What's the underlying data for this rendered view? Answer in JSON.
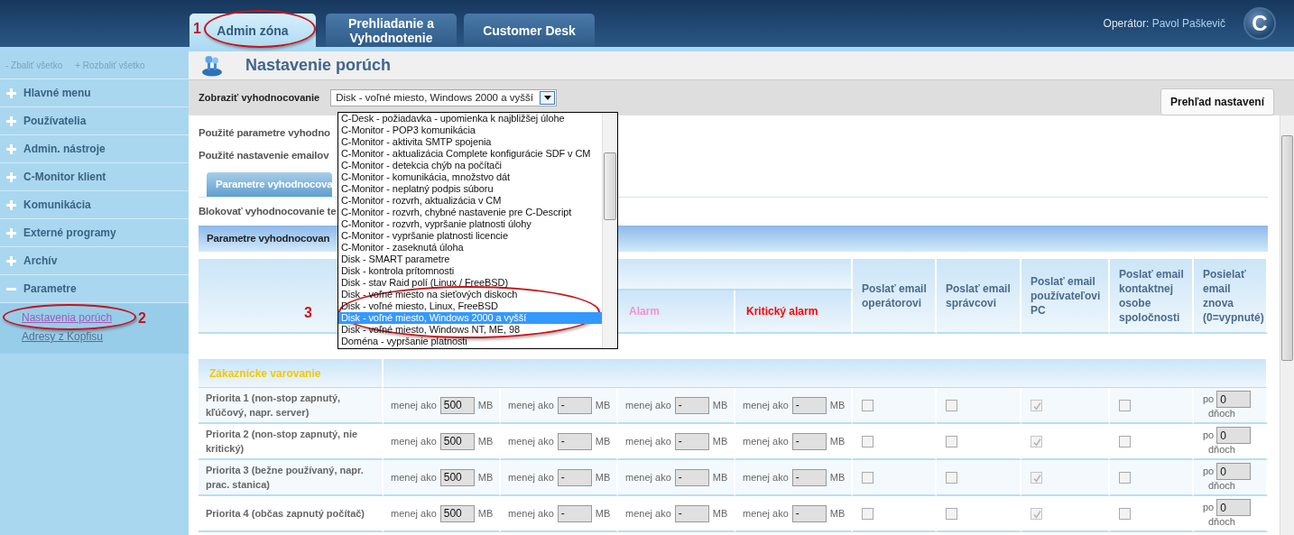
{
  "header": {
    "tabs": [
      {
        "label": "Admin zóna",
        "selected": true,
        "annotation": "1"
      },
      {
        "label": "Prehliadanie a Vyhodnotenie",
        "selected": false
      },
      {
        "label": "Customer Desk",
        "selected": false
      }
    ],
    "operator_label": "Operátor:",
    "operator_name": "Pavol Paškevič",
    "logo_letter": "C"
  },
  "sidebar": {
    "collapse_all": "- Zbaliť všetko",
    "expand_all": "+ Rozbaliť všetko",
    "items": [
      {
        "label": "Hlavné menu",
        "expanded": false
      },
      {
        "label": "Používatelia",
        "expanded": false
      },
      {
        "label": "Admin. nástroje",
        "expanded": false
      },
      {
        "label": "C-Monitor klient",
        "expanded": false
      },
      {
        "label": "Komunikácia",
        "expanded": false
      },
      {
        "label": "Externé programy",
        "expanded": false
      },
      {
        "label": "Archív",
        "expanded": false
      },
      {
        "label": "Parametre",
        "expanded": true,
        "children": [
          {
            "label": "Nastavenia porúch",
            "selected": true,
            "annotation": "2"
          },
          {
            "label": "Adresy z Kopfisu",
            "selected": false
          }
        ]
      }
    ]
  },
  "page": {
    "title": "Nastavenie porúch",
    "filter_label": "Zobraziť vyhodnocovanie",
    "filter_value": "Disk - voľné miesto, Windows 2000 a vyšší",
    "overview_button": "Prehľad nastavení"
  },
  "dropdown": {
    "expanded": true,
    "annotation": "3",
    "options": [
      {
        "label": "C-Desk - požiadavka - upomienka k najbližšej úlohe",
        "selected": false,
        "circled": false
      },
      {
        "label": "C-Monitor - POP3 komunikácia",
        "selected": false,
        "circled": false
      },
      {
        "label": "C-Monitor - aktivita SMTP spojenia",
        "selected": false,
        "circled": false
      },
      {
        "label": "C-Monitor - aktualizácia Complete konfigurácie SDF v CM",
        "selected": false,
        "circled": false
      },
      {
        "label": "C-Monitor - detekcia chýb na počítači",
        "selected": false,
        "circled": false
      },
      {
        "label": "C-Monitor - komunikácia, množstvo dát",
        "selected": false,
        "circled": false
      },
      {
        "label": "C-Monitor - neplatný podpis súboru",
        "selected": false,
        "circled": false
      },
      {
        "label": "C-Monitor - rozvrh, aktualizácia v CM",
        "selected": false,
        "circled": false
      },
      {
        "label": "C-Monitor - rozvrh, chybné nastavenie pre C-Descript",
        "selected": false,
        "circled": false
      },
      {
        "label": "C-Monitor - rozvrh, vypršanie platnosti úlohy",
        "selected": false,
        "circled": false
      },
      {
        "label": "C-Monitor - vypršanie platnosti licencie",
        "selected": false,
        "circled": false
      },
      {
        "label": "C-Monitor - zaseknutá úloha",
        "selected": false,
        "circled": false
      },
      {
        "label": "Disk - SMART parametre",
        "selected": false,
        "circled": false
      },
      {
        "label": "Disk - kontrola prítomnosti",
        "selected": false,
        "circled": false
      },
      {
        "label": "Disk - stav Raid polí (Linux / FreeBSD)",
        "selected": false,
        "circled": false
      },
      {
        "label": "Disk - voľné miesto na sieťových diskoch",
        "selected": false,
        "circled": true
      },
      {
        "label": "Disk - voľné miesto, Linux, FreeBSD",
        "selected": false,
        "circled": true
      },
      {
        "label": "Disk - voľné miesto, Windows 2000 a vyšší",
        "selected": true,
        "circled": true
      },
      {
        "label": "Disk - voľné miesto, Windows NT, ME, 98",
        "selected": false,
        "circled": true
      },
      {
        "label": "Doména - vypršanie platnosti",
        "selected": false,
        "circled": false
      }
    ]
  },
  "content": {
    "used_params": "Použité parametre vyhodno",
    "used_email": "Použité nastavenie emailov",
    "tabs": [
      {
        "label": "Parametre vyhodnocova",
        "selected": true
      }
    ],
    "block_label": "Blokovať vyhodnocovanie te",
    "section_title": "Parametre vyhodnocovan"
  },
  "table": {
    "threshold_headers": [
      {
        "label": "Alarm",
        "color": "#f590cf"
      },
      {
        "label": "Kritický alarm",
        "color": "#ff0000"
      }
    ],
    "email_columns": [
      "Poslať email operátorovi",
      "Poslať email správcovi",
      "Poslať email používateľovi PC",
      "Poslať email kontaktnej osobe spoločnosti",
      "Posielať email znova (0=vypnuté)"
    ],
    "group_title": "Zákaznícke varovanie",
    "rows": [
      {
        "label": "Priorita 1 (non-stop zapnutý, kľúčový, napr. server)",
        "thresholds": [
          {
            "prefix": "menej ako",
            "value": "500",
            "unit": "MB"
          },
          {
            "prefix": "menej ako",
            "value": "-",
            "unit": "MB"
          },
          {
            "prefix": "menej ako",
            "value": "-",
            "unit": "MB"
          },
          {
            "prefix": "menej ako",
            "value": "-",
            "unit": "MB"
          }
        ],
        "emails": [
          {
            "checked": false,
            "disabled": false
          },
          {
            "checked": false,
            "disabled": false
          },
          {
            "checked": true,
            "disabled": true
          },
          {
            "checked": false,
            "disabled": false
          }
        ],
        "resend": {
          "prefix": "po",
          "value": "0",
          "unit": "dňoch"
        }
      },
      {
        "label": "Priorita 2 (non-stop zapnutý, nie kritický)",
        "thresholds": [
          {
            "prefix": "menej ako",
            "value": "500",
            "unit": "MB"
          },
          {
            "prefix": "menej ako",
            "value": "-",
            "unit": "MB"
          },
          {
            "prefix": "menej ako",
            "value": "-",
            "unit": "MB"
          },
          {
            "prefix": "menej ako",
            "value": "-",
            "unit": "MB"
          }
        ],
        "emails": [
          {
            "checked": false,
            "disabled": false
          },
          {
            "checked": false,
            "disabled": false
          },
          {
            "checked": true,
            "disabled": true
          },
          {
            "checked": false,
            "disabled": false
          }
        ],
        "resend": {
          "prefix": "po",
          "value": "0",
          "unit": "dňoch"
        }
      },
      {
        "label": "Priorita 3 (bežne používaný, napr. prac. stanica)",
        "thresholds": [
          {
            "prefix": "menej ako",
            "value": "500",
            "unit": "MB"
          },
          {
            "prefix": "menej ako",
            "value": "-",
            "unit": "MB"
          },
          {
            "prefix": "menej ako",
            "value": "-",
            "unit": "MB"
          },
          {
            "prefix": "menej ako",
            "value": "-",
            "unit": "MB"
          }
        ],
        "emails": [
          {
            "checked": false,
            "disabled": false
          },
          {
            "checked": false,
            "disabled": false
          },
          {
            "checked": true,
            "disabled": true
          },
          {
            "checked": false,
            "disabled": false
          }
        ],
        "resend": {
          "prefix": "po",
          "value": "0",
          "unit": "dňoch"
        }
      },
      {
        "label": "Priorita 4 (občas zapnutý počítač)",
        "thresholds": [
          {
            "prefix": "menej ako",
            "value": "500",
            "unit": "MB"
          },
          {
            "prefix": "menej ako",
            "value": "-",
            "unit": "MB"
          },
          {
            "prefix": "menej ako",
            "value": "-",
            "unit": "MB"
          },
          {
            "prefix": "menej ako",
            "value": "-",
            "unit": "MB"
          }
        ],
        "emails": [
          {
            "checked": false,
            "disabled": false
          },
          {
            "checked": false,
            "disabled": false
          },
          {
            "checked": true,
            "disabled": true
          },
          {
            "checked": false,
            "disabled": false
          }
        ],
        "resend": {
          "prefix": "po",
          "value": "0",
          "unit": "dňoch"
        }
      }
    ]
  }
}
